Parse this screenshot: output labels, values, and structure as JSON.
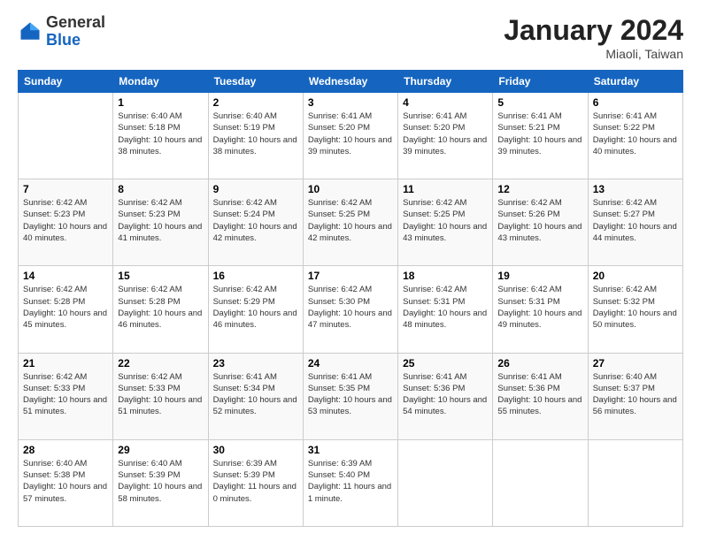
{
  "header": {
    "logo_general": "General",
    "logo_blue": "Blue",
    "month_year": "January 2024",
    "location": "Miaoli, Taiwan"
  },
  "days_of_week": [
    "Sunday",
    "Monday",
    "Tuesday",
    "Wednesday",
    "Thursday",
    "Friday",
    "Saturday"
  ],
  "weeks": [
    [
      {
        "day": "",
        "sunrise": "",
        "sunset": "",
        "daylight": ""
      },
      {
        "day": "1",
        "sunrise": "Sunrise: 6:40 AM",
        "sunset": "Sunset: 5:18 PM",
        "daylight": "Daylight: 10 hours and 38 minutes."
      },
      {
        "day": "2",
        "sunrise": "Sunrise: 6:40 AM",
        "sunset": "Sunset: 5:19 PM",
        "daylight": "Daylight: 10 hours and 38 minutes."
      },
      {
        "day": "3",
        "sunrise": "Sunrise: 6:41 AM",
        "sunset": "Sunset: 5:20 PM",
        "daylight": "Daylight: 10 hours and 39 minutes."
      },
      {
        "day": "4",
        "sunrise": "Sunrise: 6:41 AM",
        "sunset": "Sunset: 5:20 PM",
        "daylight": "Daylight: 10 hours and 39 minutes."
      },
      {
        "day": "5",
        "sunrise": "Sunrise: 6:41 AM",
        "sunset": "Sunset: 5:21 PM",
        "daylight": "Daylight: 10 hours and 39 minutes."
      },
      {
        "day": "6",
        "sunrise": "Sunrise: 6:41 AM",
        "sunset": "Sunset: 5:22 PM",
        "daylight": "Daylight: 10 hours and 40 minutes."
      }
    ],
    [
      {
        "day": "7",
        "sunrise": "Sunrise: 6:42 AM",
        "sunset": "Sunset: 5:23 PM",
        "daylight": "Daylight: 10 hours and 40 minutes."
      },
      {
        "day": "8",
        "sunrise": "Sunrise: 6:42 AM",
        "sunset": "Sunset: 5:23 PM",
        "daylight": "Daylight: 10 hours and 41 minutes."
      },
      {
        "day": "9",
        "sunrise": "Sunrise: 6:42 AM",
        "sunset": "Sunset: 5:24 PM",
        "daylight": "Daylight: 10 hours and 42 minutes."
      },
      {
        "day": "10",
        "sunrise": "Sunrise: 6:42 AM",
        "sunset": "Sunset: 5:25 PM",
        "daylight": "Daylight: 10 hours and 42 minutes."
      },
      {
        "day": "11",
        "sunrise": "Sunrise: 6:42 AM",
        "sunset": "Sunset: 5:25 PM",
        "daylight": "Daylight: 10 hours and 43 minutes."
      },
      {
        "day": "12",
        "sunrise": "Sunrise: 6:42 AM",
        "sunset": "Sunset: 5:26 PM",
        "daylight": "Daylight: 10 hours and 43 minutes."
      },
      {
        "day": "13",
        "sunrise": "Sunrise: 6:42 AM",
        "sunset": "Sunset: 5:27 PM",
        "daylight": "Daylight: 10 hours and 44 minutes."
      }
    ],
    [
      {
        "day": "14",
        "sunrise": "Sunrise: 6:42 AM",
        "sunset": "Sunset: 5:28 PM",
        "daylight": "Daylight: 10 hours and 45 minutes."
      },
      {
        "day": "15",
        "sunrise": "Sunrise: 6:42 AM",
        "sunset": "Sunset: 5:28 PM",
        "daylight": "Daylight: 10 hours and 46 minutes."
      },
      {
        "day": "16",
        "sunrise": "Sunrise: 6:42 AM",
        "sunset": "Sunset: 5:29 PM",
        "daylight": "Daylight: 10 hours and 46 minutes."
      },
      {
        "day": "17",
        "sunrise": "Sunrise: 6:42 AM",
        "sunset": "Sunset: 5:30 PM",
        "daylight": "Daylight: 10 hours and 47 minutes."
      },
      {
        "day": "18",
        "sunrise": "Sunrise: 6:42 AM",
        "sunset": "Sunset: 5:31 PM",
        "daylight": "Daylight: 10 hours and 48 minutes."
      },
      {
        "day": "19",
        "sunrise": "Sunrise: 6:42 AM",
        "sunset": "Sunset: 5:31 PM",
        "daylight": "Daylight: 10 hours and 49 minutes."
      },
      {
        "day": "20",
        "sunrise": "Sunrise: 6:42 AM",
        "sunset": "Sunset: 5:32 PM",
        "daylight": "Daylight: 10 hours and 50 minutes."
      }
    ],
    [
      {
        "day": "21",
        "sunrise": "Sunrise: 6:42 AM",
        "sunset": "Sunset: 5:33 PM",
        "daylight": "Daylight: 10 hours and 51 minutes."
      },
      {
        "day": "22",
        "sunrise": "Sunrise: 6:42 AM",
        "sunset": "Sunset: 5:33 PM",
        "daylight": "Daylight: 10 hours and 51 minutes."
      },
      {
        "day": "23",
        "sunrise": "Sunrise: 6:41 AM",
        "sunset": "Sunset: 5:34 PM",
        "daylight": "Daylight: 10 hours and 52 minutes."
      },
      {
        "day": "24",
        "sunrise": "Sunrise: 6:41 AM",
        "sunset": "Sunset: 5:35 PM",
        "daylight": "Daylight: 10 hours and 53 minutes."
      },
      {
        "day": "25",
        "sunrise": "Sunrise: 6:41 AM",
        "sunset": "Sunset: 5:36 PM",
        "daylight": "Daylight: 10 hours and 54 minutes."
      },
      {
        "day": "26",
        "sunrise": "Sunrise: 6:41 AM",
        "sunset": "Sunset: 5:36 PM",
        "daylight": "Daylight: 10 hours and 55 minutes."
      },
      {
        "day": "27",
        "sunrise": "Sunrise: 6:40 AM",
        "sunset": "Sunset: 5:37 PM",
        "daylight": "Daylight: 10 hours and 56 minutes."
      }
    ],
    [
      {
        "day": "28",
        "sunrise": "Sunrise: 6:40 AM",
        "sunset": "Sunset: 5:38 PM",
        "daylight": "Daylight: 10 hours and 57 minutes."
      },
      {
        "day": "29",
        "sunrise": "Sunrise: 6:40 AM",
        "sunset": "Sunset: 5:39 PM",
        "daylight": "Daylight: 10 hours and 58 minutes."
      },
      {
        "day": "30",
        "sunrise": "Sunrise: 6:39 AM",
        "sunset": "Sunset: 5:39 PM",
        "daylight": "Daylight: 11 hours and 0 minutes."
      },
      {
        "day": "31",
        "sunrise": "Sunrise: 6:39 AM",
        "sunset": "Sunset: 5:40 PM",
        "daylight": "Daylight: 11 hours and 1 minute."
      },
      {
        "day": "",
        "sunrise": "",
        "sunset": "",
        "daylight": ""
      },
      {
        "day": "",
        "sunrise": "",
        "sunset": "",
        "daylight": ""
      },
      {
        "day": "",
        "sunrise": "",
        "sunset": "",
        "daylight": ""
      }
    ]
  ]
}
